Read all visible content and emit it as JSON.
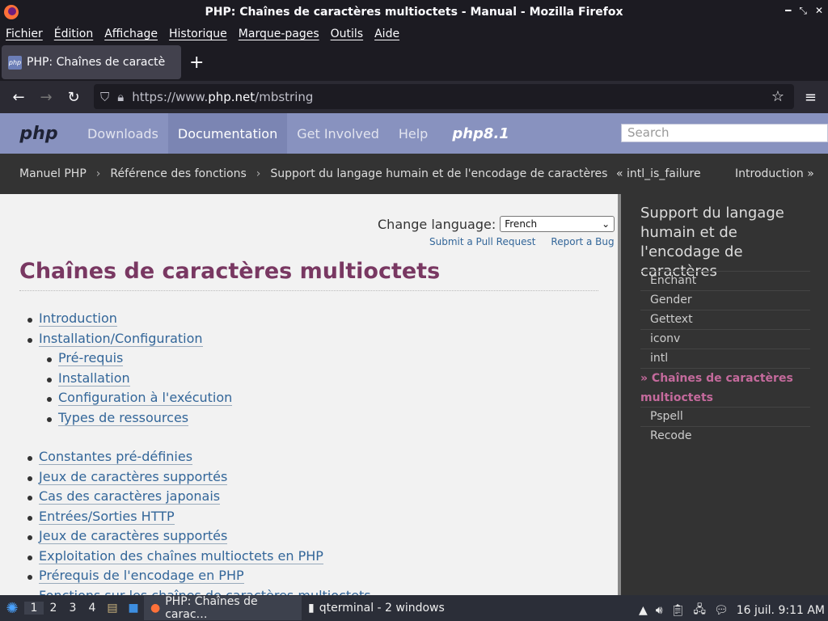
{
  "window": {
    "title": "PHP: Chaînes de caractères multioctets - Manual - Mozilla Firefox"
  },
  "menu": [
    "Fichier",
    "Édition",
    "Affichage",
    "Historique",
    "Marque-pages",
    "Outils",
    "Aide"
  ],
  "tab": {
    "label": "PHP: Chaînes de caractè",
    "favicon": "php"
  },
  "url": {
    "prefix": "https://www.",
    "domain": "php.net",
    "path": "/mbstring"
  },
  "php": {
    "logo": "php",
    "nav": [
      "Downloads",
      "Documentation",
      "Get Involved",
      "Help"
    ],
    "version": "php8.1",
    "search_placeholder": "Search"
  },
  "breadcrumb": {
    "items": [
      "Manuel PHP",
      "Référence des fonctions",
      "Support du langage humain et de l'encodage de caractères"
    ],
    "prev": "« intl_is_failure",
    "next": "Introduction »"
  },
  "content": {
    "change_language_label": "Change language:",
    "language_selected": "French",
    "pull_request": "Submit a Pull Request",
    "report_bug": "Report a Bug",
    "title": "Chaînes de caractères multioctets",
    "toc": [
      "Introduction",
      "Installation/Configuration"
    ],
    "toc_sub": [
      "Pré-requis",
      "Installation",
      "Configuration à l'exécution",
      "Types de ressources"
    ],
    "toc2": [
      "Constantes pré-définies",
      "Jeux de caractères supportés",
      "Cas des caractères japonais",
      "Entrées/Sorties HTTP",
      "Jeux de caractères supportés",
      "Exploitation des chaînes multioctets en PHP",
      "Prérequis de l'encodage en PHP",
      "Fonctions sur les chaînes de caractères multioctets"
    ]
  },
  "sidebar": {
    "title": "Support du langage humain et de l'encodage de caractères",
    "items": [
      "Enchant",
      "Gender",
      "Gettext",
      "iconv",
      "intl"
    ],
    "current": "» Chaînes de caractères multioctets",
    "items2": [
      "Pspell",
      "Recode"
    ]
  },
  "taskbar": {
    "workspaces": [
      "1",
      "2",
      "3",
      "4"
    ],
    "firefox_task": "PHP: Chaînes de carac…",
    "terminal_task": "qterminal - 2 windows",
    "clock": "16 juil. 9:11 AM"
  }
}
